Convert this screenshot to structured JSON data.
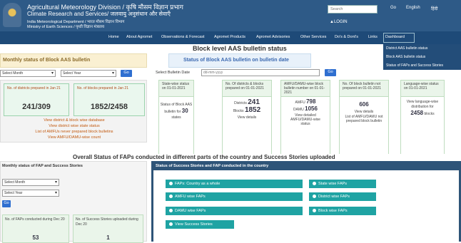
{
  "header": {
    "line1": "Agricultural Meteorology Division / कृषि मौसम विज्ञान प्रभाग",
    "line2": "Climate Research and Services/ जलवायु अनुसंधान और सेवाएँ",
    "line3": "India Meteorological Department / भारत मौसम विज्ञान विभाग",
    "line4": "Ministry of Earth Sciences / पृथ्वी विज्ञान मंत्रालय",
    "search_placeholder": "Search",
    "go": "Go",
    "english": "English",
    "hindi": "हिंदी",
    "login": "LOGIN"
  },
  "nav": {
    "items": [
      "Home",
      "About Agromet",
      "Observations & Forecast",
      "Agromet Products",
      "Agromet Advisories",
      "Other Services",
      "Do's & Dont's",
      "Links",
      "Dashboard"
    ]
  },
  "dropdown": {
    "items": [
      "District AAS bulletin status",
      "Block AAS bulletin status",
      "Status of FAPs and Success Stories"
    ]
  },
  "page_title": "Block level AAS bulletin status",
  "monthly": {
    "header": "Monthly status of Block AAS bulletin",
    "month_select": "Select Month",
    "year_select": "Select Year",
    "go": "Go",
    "card1_label": "No. of districts prepared in Jan 21",
    "card1_value": "241/309",
    "card2_label": "No. of blocks prepared in Jan 21",
    "card2_value": "1852/2458",
    "links": [
      "View district & block wise database",
      "View district wise state status",
      "List of AMFUs never prepared block bulletins",
      "View AMFU/DAMU-wise count"
    ]
  },
  "daily": {
    "header": "Status of Block AAS bulletin on bulletin date",
    "date_label": "Select Bulletin Date",
    "date_placeholder": "dd-mm-yyyy",
    "go": "Go"
  },
  "cards": [
    {
      "head": "State-wise status on 01-01-2021",
      "body": [
        "Status of Block AAS",
        "bulletin for",
        "30",
        "states"
      ]
    },
    {
      "head": "No. Of districts & blocks prepared on 01-01-2021",
      "l1": "Districts",
      "v1": "241",
      "l2": "Blocks",
      "v2": "1852",
      "link": "View details"
    },
    {
      "head": "AMFU/DAMU-wise block bulletin number on 01-01-2021",
      "l1": "AMFU",
      "v1": "798",
      "l2": "DAMU",
      "v2": "1056",
      "link": "View detailed AMFU/DAMU-wise status"
    },
    {
      "head": "No. Of block bulletin not prepared on 01-01-2021",
      "v1": "606",
      "link": "View details",
      "link2": "List of AMFU/DAMU not prepared block bulletin"
    },
    {
      "head": "Language-wise status on 01-01-2021",
      "body": [
        "View language-wise",
        "distribution for",
        "2458",
        "blocks"
      ]
    }
  ],
  "overall_title": "Overall Status of FAPs conducted in different parts of the country and Success Stories uploaded",
  "fap": {
    "title": "Monthly status of FAP and Success Stories",
    "month_select": "Select Month",
    "year_select": "Select Year",
    "go": "Go",
    "c1_label": "No. of FAPs conducted during Dec 20",
    "c1_value": "53",
    "c2_label": "No. of Success Stories uploaded during Dec 20",
    "c2_value": "1"
  },
  "stories": {
    "title": "Status of Success Stories and FAP conducted in the country",
    "buttons": [
      "FAPs: Country as a whole",
      "State wise FAPs",
      "AMFU wise FAPs",
      "District wise FAPs",
      "DAMU wise FAPs",
      "Block wise FAPs",
      "View Success Stories"
    ]
  },
  "colors": {
    "header_bg": "#2e5a87",
    "nav_bg": "#1e4a78",
    "teal_button": "#1fa3a3",
    "go_button": "#2f6fd0"
  }
}
